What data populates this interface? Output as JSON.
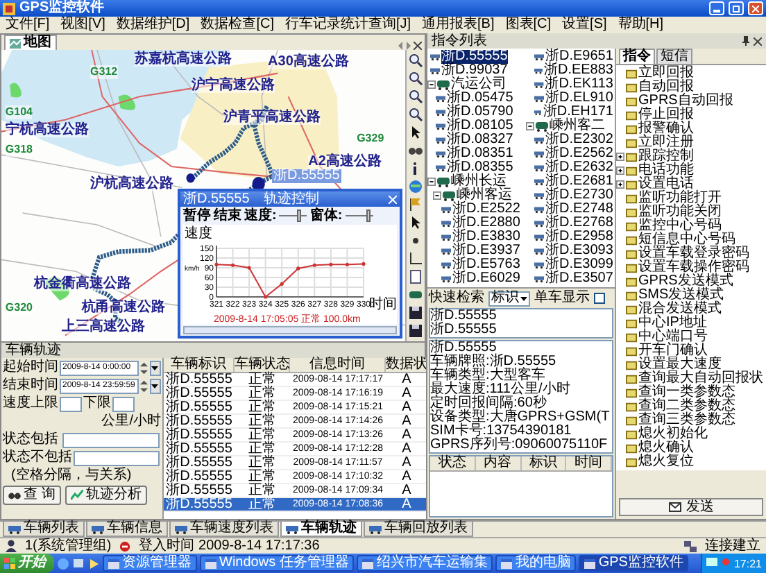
{
  "window": {
    "title": "GPS监控软件"
  },
  "menu": [
    "文件[F]",
    "视图[V]",
    "数据维护[D]",
    "数据检查[C]",
    "行车记录统计查询[J]",
    "通用报表[B]",
    "图表[C]",
    "设置[S]",
    "帮助[H]"
  ],
  "map_panel": {
    "tab": {
      "label": "地图",
      "selected": true
    },
    "marker_label": "浙D.55555",
    "labels": [
      {
        "text": "G312",
        "kind": "road-number"
      },
      {
        "text": "苏嘉杭高速公路",
        "kind": "highway"
      },
      {
        "text": "沪宁高速公路",
        "kind": "highway"
      },
      {
        "text": "A30高速公路",
        "kind": "highway"
      },
      {
        "text": "G104",
        "kind": "road-number"
      },
      {
        "text": "宁杭高速公路",
        "kind": "highway"
      },
      {
        "text": "G318",
        "kind": "road-number"
      },
      {
        "text": "沪青平高速公路",
        "kind": "highway"
      },
      {
        "text": "A2高速公路",
        "kind": "highway"
      },
      {
        "text": "沪杭高速公路",
        "kind": "highway"
      },
      {
        "text": "杭金衢高速公路",
        "kind": "highway"
      },
      {
        "text": "G320",
        "kind": "road-number"
      },
      {
        "text": "上三高速公路",
        "kind": "highway"
      },
      {
        "text": "G329",
        "kind": "road-number"
      },
      {
        "text": "杭甬高速公路",
        "kind": "highway"
      }
    ]
  },
  "track_control": {
    "vehicle": "浙D.55555",
    "title": "轨迹控制",
    "buttons": [
      "暂停",
      "结束"
    ],
    "speed": {
      "label": "速度:",
      "level": 0.75
    },
    "window": {
      "label": "窗体:",
      "level": 0.9
    },
    "chart_data": {
      "type": "line",
      "ylabel": "速度",
      "xlabel": "时间",
      "grid": true,
      "categories": [
        "321",
        "322",
        "323",
        "324",
        "325",
        "326",
        "327",
        "328",
        "329",
        "330"
      ],
      "ylim": [
        0,
        150
      ],
      "yticks": [
        0,
        30,
        60,
        90,
        120,
        150
      ],
      "series": [
        {
          "color": "#cc3333",
          "values": [
            100,
            98,
            90,
            0,
            40,
            88,
            98,
            100,
            100,
            102
          ]
        }
      ],
      "annotations": [
        "km/h",
        "2009-8-14 17:05:05 正常 100.0km"
      ]
    }
  },
  "track_panel": {
    "title": "车辆轨迹",
    "start": {
      "label": "起始时间",
      "value": "2009-8-14 0:00:00"
    },
    "end": {
      "label": "结束时间",
      "value": "2009-8-14 23:59:59"
    },
    "speed_upper": "速度上限",
    "speed_lower": "下限",
    "speed_unit": "公里/小时",
    "include": "状态包括",
    "exclude": "状态不包括",
    "hint": "(空格分隔，与关系)",
    "query_button": "查 询",
    "analyze_button": "轨迹分析"
  },
  "vehicle_table": {
    "columns": [
      "车辆标识",
      "车辆状态",
      "信息时间",
      "数据状"
    ],
    "rows": [
      {
        "cells": [
          "浙D.55555",
          "正常",
          "2009-08-14 17:17:17",
          "A"
        ],
        "selected": false
      },
      {
        "cells": [
          "浙D.55555",
          "正常",
          "2009-08-14 17:16:19",
          "A"
        ],
        "selected": false
      },
      {
        "cells": [
          "浙D.55555",
          "正常",
          "2009-08-14 17:15:21",
          "A"
        ],
        "selected": false
      },
      {
        "cells": [
          "浙D.55555",
          "正常",
          "2009-08-14 17:14:26",
          "A"
        ],
        "selected": false
      },
      {
        "cells": [
          "浙D.55555",
          "正常",
          "2009-08-14 17:13:26",
          "A"
        ],
        "selected": false
      },
      {
        "cells": [
          "浙D.55555",
          "正常",
          "2009-08-14 17:12:28",
          "A"
        ],
        "selected": false
      },
      {
        "cells": [
          "浙D.55555",
          "正常",
          "2009-08-14 17:11:57",
          "A"
        ],
        "selected": false
      },
      {
        "cells": [
          "浙D.55555",
          "正常",
          "2009-08-14 17:10:32",
          "A"
        ],
        "selected": false
      },
      {
        "cells": [
          "浙D.55555",
          "正常",
          "2009-08-14 17:09:34",
          "A"
        ],
        "selected": false
      },
      {
        "cells": [
          "浙D.55555",
          "正常",
          "2009-08-14 17:08:36",
          "A"
        ],
        "selected": true
      }
    ]
  },
  "command_panel": {
    "title": "指令列表",
    "vehicle_tree": [
      {
        "kind": "vehicle",
        "label": "浙D.55555",
        "selected": true
      },
      {
        "kind": "vehicle",
        "label": "浙D.99037",
        "selected": false
      },
      {
        "kind": "group",
        "label": "汽运公司",
        "expanded": true,
        "children": [
          {
            "kind": "vehicle",
            "label": "浙D.05475",
            "selected": false
          },
          {
            "kind": "vehicle",
            "label": "浙D.05790",
            "selected": false
          },
          {
            "kind": "vehicle",
            "label": "浙D.08105",
            "selected": false
          },
          {
            "kind": "vehicle",
            "label": "浙D.08327",
            "selected": false
          },
          {
            "kind": "vehicle",
            "label": "浙D.08351",
            "selected": false
          },
          {
            "kind": "vehicle",
            "label": "浙D.08355",
            "selected": false
          }
        ]
      },
      {
        "kind": "group",
        "label": "嵊州长运",
        "expanded": true,
        "children": [
          {
            "kind": "group",
            "label": "嵊州客运",
            "expanded": true,
            "children": [
              {
                "kind": "vehicle",
                "label": "浙D.E2522",
                "selected": false
              },
              {
                "kind": "vehicle",
                "label": "浙D.E2880",
                "selected": false
              },
              {
                "kind": "vehicle",
                "label": "浙D.E3830",
                "selected": false
              },
              {
                "kind": "vehicle",
                "label": "浙D.E3937",
                "selected": false
              },
              {
                "kind": "vehicle",
                "label": "浙D.E5763",
                "selected": false
              },
              {
                "kind": "vehicle",
                "label": "浙D.E6029",
                "selected": false
              },
              {
                "kind": "vehicle",
                "label": "浙D.E9651",
                "selected": false
              },
              {
                "kind": "vehicle",
                "label": "浙D.EE883",
                "selected": false
              },
              {
                "kind": "vehicle",
                "label": "浙D.EK113",
                "selected": false
              },
              {
                "kind": "vehicle",
                "label": "浙D.EL910",
                "selected": false
              },
              {
                "kind": "vehicle",
                "label": "浙D.EH171",
                "selected": false
              }
            ]
          },
          {
            "kind": "group",
            "label": "嵊州客二",
            "expanded": true,
            "children": [
              {
                "kind": "vehicle",
                "label": "浙D.E2302",
                "selected": false
              },
              {
                "kind": "vehicle",
                "label": "浙D.E2562",
                "selected": false
              },
              {
                "kind": "vehicle",
                "label": "浙D.E2632",
                "selected": false
              },
              {
                "kind": "vehicle",
                "label": "浙D.E2681",
                "selected": false
              },
              {
                "kind": "vehicle",
                "label": "浙D.E2730",
                "selected": false
              },
              {
                "kind": "vehicle",
                "label": "浙D.E2748",
                "selected": false
              },
              {
                "kind": "vehicle",
                "label": "浙D.E2768",
                "selected": false
              },
              {
                "kind": "vehicle",
                "label": "浙D.E2958",
                "selected": false
              },
              {
                "kind": "vehicle",
                "label": "浙D.E3093",
                "selected": false
              },
              {
                "kind": "vehicle",
                "label": "浙D.E3099",
                "selected": false
              },
              {
                "kind": "vehicle",
                "label": "浙D.E3507",
                "selected": false
              }
            ]
          }
        ]
      }
    ],
    "tabs": [
      {
        "label": "指令",
        "selected": true
      },
      {
        "label": "短信",
        "selected": false
      }
    ],
    "commands": [
      {
        "label": "立即回报",
        "expandable": false
      },
      {
        "label": "自动回报",
        "expandable": false
      },
      {
        "label": "GPRS自动回报",
        "expandable": false
      },
      {
        "label": "停止回报",
        "expandable": false
      },
      {
        "label": "报警确认",
        "expandable": false
      },
      {
        "label": "立即注册",
        "expandable": false
      },
      {
        "label": "跟踪控制",
        "expandable": true
      },
      {
        "label": "电话功能",
        "expandable": true
      },
      {
        "label": "设置电话",
        "expandable": true
      },
      {
        "label": "监听功能打开",
        "expandable": false
      },
      {
        "label": "监听功能关闭",
        "expandable": false
      },
      {
        "label": "监控中心号码",
        "expandable": false
      },
      {
        "label": "短信息中心号码",
        "expandable": false
      },
      {
        "label": "设置车载登录密码",
        "expandable": false
      },
      {
        "label": "设置车载操作密码",
        "expandable": false
      },
      {
        "label": "GPRS发送模式",
        "expandable": false
      },
      {
        "label": "SMS发送模式",
        "expandable": false
      },
      {
        "label": "混合发送模式",
        "expandable": false
      },
      {
        "label": "中心IP地址",
        "expandable": false
      },
      {
        "label": "中心端口号",
        "expandable": false
      },
      {
        "label": "开车门确认",
        "expandable": false
      },
      {
        "label": "设置最大速度",
        "expandable": false
      },
      {
        "label": "查询最大自动回报状",
        "expandable": false
      },
      {
        "label": "查询一类参数态",
        "expandable": false
      },
      {
        "label": "查询二类参数态",
        "expandable": false
      },
      {
        "label": "查询三类参数态",
        "expandable": false
      },
      {
        "label": "熄火初始化",
        "expandable": false
      },
      {
        "label": "熄火确认",
        "expandable": false
      },
      {
        "label": "熄火复位",
        "expandable": false
      }
    ],
    "send_button": "发送"
  },
  "quick_search": {
    "label": "快速检索",
    "field": "标识",
    "single_label": "单车显示",
    "single_checked": false,
    "results": [
      "浙D.55555",
      "浙D.55555"
    ],
    "info": [
      "浙D.55555",
      "车辆牌照:浙D.55555",
      "车辆类型:大型客车",
      "最大速度:111公里/小时",
      "定时回报间隔:60秒",
      "设备类型:大唐GPRS+GSM(T",
      "SIM卡号:13754390181",
      "GPRS序列号:09060075110F"
    ],
    "columns": [
      "状态",
      "内容",
      "标识",
      "时间"
    ]
  },
  "bottom_tabs": [
    {
      "label": "车辆列表",
      "selected": false
    },
    {
      "label": "车辆信息",
      "selected": false
    },
    {
      "label": "车辆速度列表",
      "selected": false
    },
    {
      "label": "车辆轨迹",
      "selected": true
    },
    {
      "label": "车辆回放列表",
      "selected": false
    }
  ],
  "status_bar": {
    "user": "1(系统管理组)",
    "login": "登入时间 2009-8-14 17:17:36",
    "connection": "连接建立"
  },
  "taskbar": {
    "start": "开始",
    "windows": [
      {
        "label": "资源管理器",
        "selected": false
      },
      {
        "label": "Windows 任务管理器",
        "selected": false
      },
      {
        "label": "绍兴市汽车运输集",
        "selected": false
      },
      {
        "label": "我的电脑",
        "selected": false
      },
      {
        "label": "GPS监控软件",
        "selected": true
      }
    ],
    "clock": "17:21"
  }
}
